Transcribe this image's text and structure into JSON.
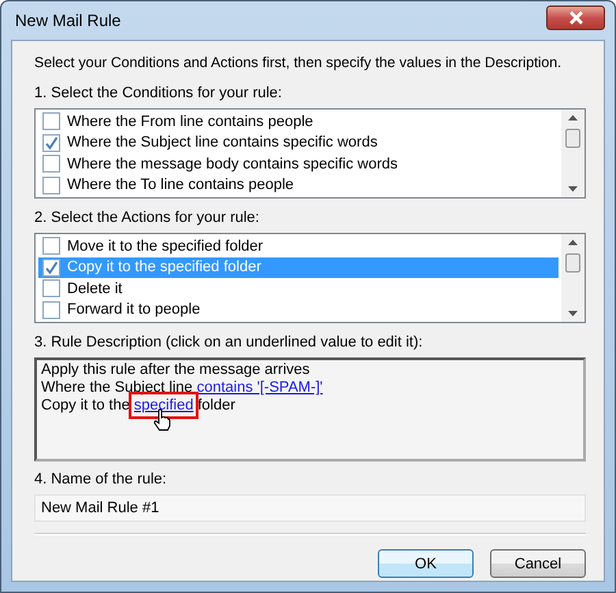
{
  "window": {
    "title": "New Mail Rule"
  },
  "instruction": "Select your Conditions and Actions first, then specify the values in the Description.",
  "conditions": {
    "label": "1. Select the Conditions for your rule:",
    "items": [
      {
        "text": "Where the From line contains people",
        "checked": false,
        "selected": false
      },
      {
        "text": "Where the Subject line contains specific words",
        "checked": true,
        "selected": false
      },
      {
        "text": "Where the message body contains specific words",
        "checked": false,
        "selected": false
      },
      {
        "text": "Where the To line contains people",
        "checked": false,
        "selected": false
      }
    ]
  },
  "actions": {
    "label": "2. Select the Actions for your rule:",
    "items": [
      {
        "text": "Move it to the specified folder",
        "checked": false,
        "selected": false
      },
      {
        "text": "Copy it to the specified folder",
        "checked": true,
        "selected": true
      },
      {
        "text": "Delete it",
        "checked": false,
        "selected": false
      },
      {
        "text": "Forward it to people",
        "checked": false,
        "selected": false
      }
    ]
  },
  "description": {
    "label": "3. Rule Description (click on an underlined value to edit it):",
    "lines": [
      [
        {
          "text": "Apply this rule after the message arrives",
          "link": false
        }
      ],
      [
        {
          "text": "Where the Subject line",
          "link": false
        },
        {
          "text": "contains '[-SPAM-]'",
          "link": true,
          "highlighted": false
        }
      ],
      [
        {
          "text": "Copy it to the",
          "link": false
        },
        {
          "text": "specified",
          "link": true,
          "highlighted": true
        },
        {
          "text": "folder",
          "link": false
        }
      ]
    ]
  },
  "rule_name": {
    "label": "4. Name of the rule:",
    "value": "New Mail Rule #1"
  },
  "buttons": [
    {
      "label": "OK",
      "default": true
    },
    {
      "label": "Cancel",
      "default": false
    }
  ]
}
